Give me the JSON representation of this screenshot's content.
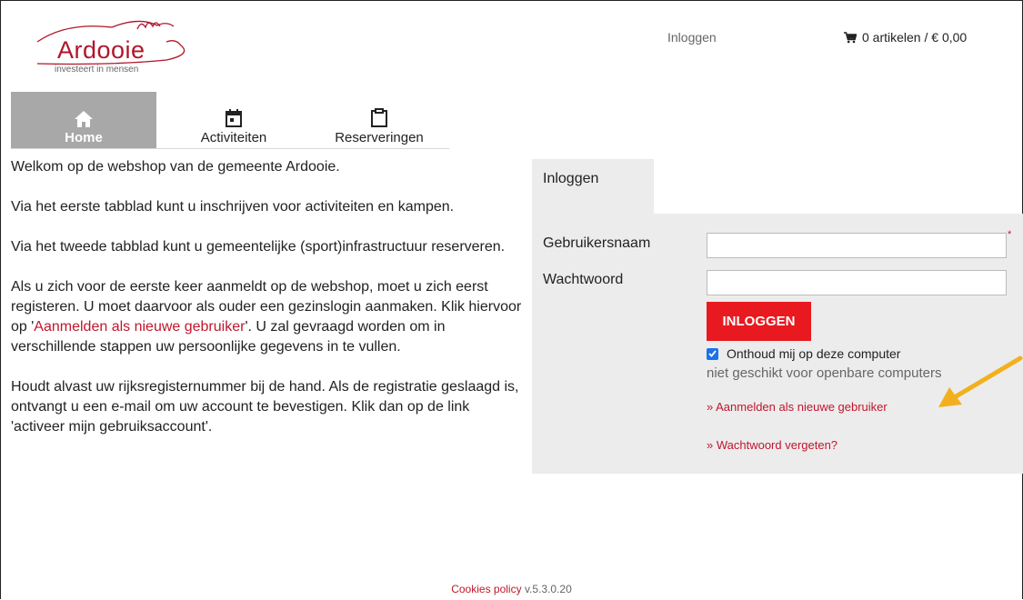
{
  "brand": {
    "name": "Ardooie",
    "tagline": "investeert in mensen"
  },
  "header": {
    "login_link": "Inloggen",
    "cart": "0 artikelen / € 0,00"
  },
  "nav": {
    "items": [
      {
        "label": "Home",
        "icon": "home-icon",
        "active": true
      },
      {
        "label": "Activiteiten",
        "icon": "calendar-icon"
      },
      {
        "label": "Reserveringen",
        "icon": "clipboard-icon"
      }
    ]
  },
  "intro": {
    "p1": "Welkom op de webshop van de gemeente Ardooie.",
    "p2": "Via het eerste tabblad kunt u inschrijven voor activiteiten en kampen.",
    "p3": "Via het tweede tabblad kunt u gemeentelijke (sport)infrastructuur reserveren.",
    "p4_before": "Als u zich voor de eerste keer aanmeldt op de webshop, moet u zich eerst registeren. U moet daarvoor als ouder een gezinslogin aanmaken. Klik hiervoor op '",
    "p4_link": "Aanmelden als nieuwe gebruiker",
    "p4_after": "'. U zal gevraagd worden om in verschillende stappen uw persoonlijke gegevens in te vullen.",
    "p5": "Houdt alvast uw rijksregisternummer bij de hand. Als de registratie geslaagd is, ontvangt u een e-mail om uw account te bevestigen. Klik dan op de link 'activeer mijn gebruiksaccount'."
  },
  "login": {
    "tab": "Inloggen",
    "username_label": "Gebruikersnaam",
    "username_value": "",
    "required_mark": "*",
    "password_label": "Wachtwoord",
    "password_value": "",
    "button": "INLOGGEN",
    "remember": "Onthoud mij op deze computer",
    "remember_checked": true,
    "hint": "niet geschikt voor openbare computers",
    "new_user": "» Aanmelden als nieuwe gebruiker",
    "forgot": "» Wachtwoord vergeten?"
  },
  "footer": {
    "cookies": "Cookies policy",
    "version": "v.5.3.0.20"
  },
  "colors": {
    "brand_red": "#c0172c",
    "button_red": "#e8191f",
    "nav_active_bg": "#a8a8a8",
    "panel_bg": "#ececec",
    "arrow": "#f2b01e"
  }
}
